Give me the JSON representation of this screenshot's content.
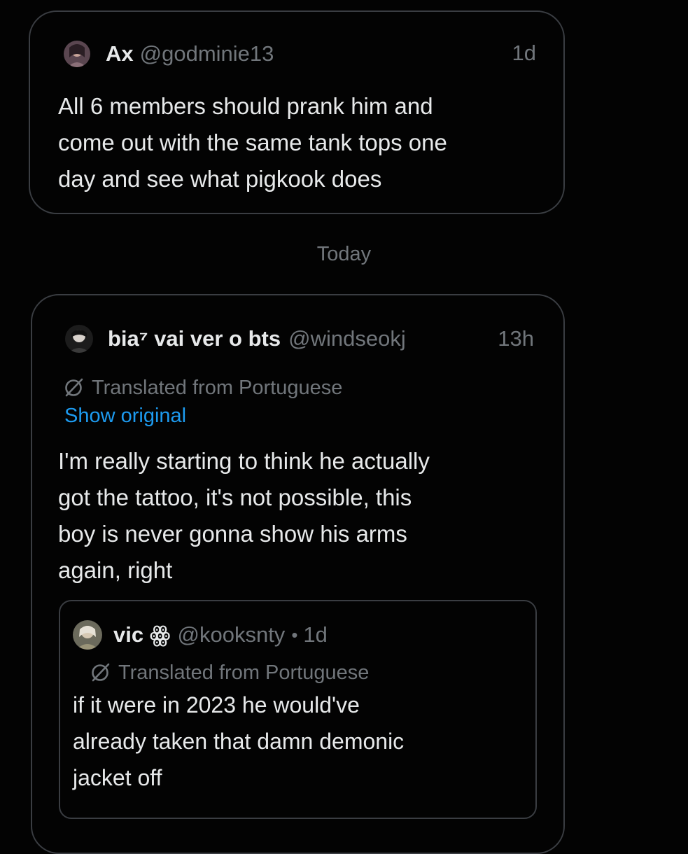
{
  "posts": [
    {
      "name": "Ax",
      "handle": "@godminie13",
      "time": "1d",
      "text_lines": [
        "All 6 members should prank him and",
        "come out with the same tank tops one",
        "day and see what pigkook does"
      ]
    },
    {
      "name": "bia⁷ vai ver o bts",
      "handle": "@windseokj",
      "time": "13h",
      "translated_label": "Translated from Portuguese",
      "show_original": "Show original",
      "text_lines": [
        "I'm really starting to think he actually",
        "got the tattoo, it's not possible, this",
        "boy is never gonna show his arms",
        "again, right"
      ],
      "quote": {
        "name": "vic ꙮ",
        "handle": "@kooksnty",
        "separator": "•",
        "time": "1d",
        "translated_label": "Translated from Portuguese",
        "text_lines": [
          "if it were in 2023 he would've",
          "already taken that damn demonic",
          "jacket off"
        ]
      }
    }
  ],
  "divider": "Today",
  "icons": {
    "translate": "translate-slash-circle-icon",
    "avatar": "avatar-image"
  },
  "colors": {
    "background": "#030303",
    "border": "#3a3d42",
    "text_primary": "#e7e9ea",
    "text_secondary": "#71767b",
    "link": "#1d9bf0"
  }
}
